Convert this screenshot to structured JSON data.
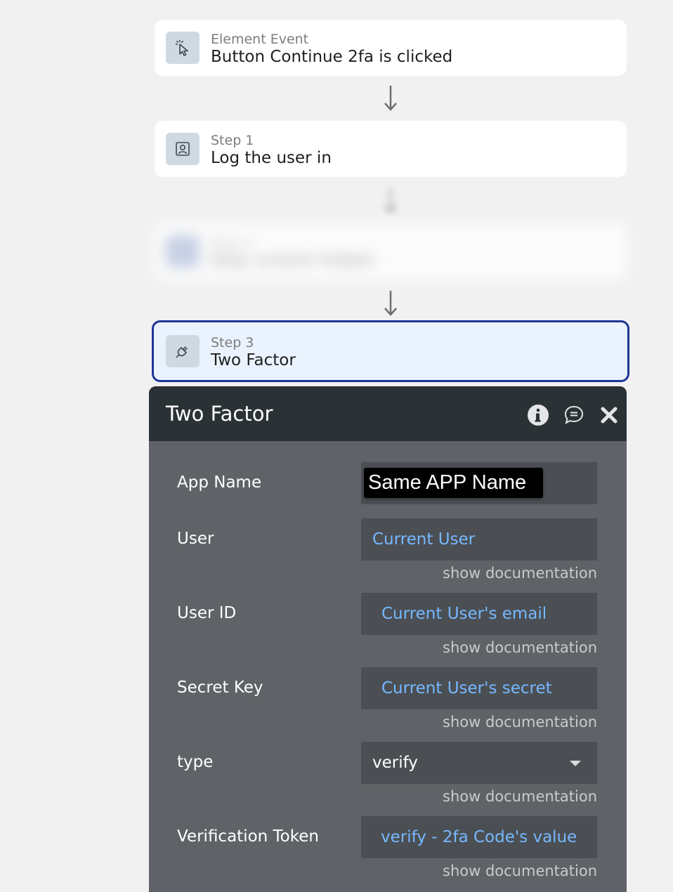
{
  "event": {
    "subtitle": "Element Event",
    "title": "Button Continue 2fa is clicked",
    "icon": "cursor-click-icon"
  },
  "step1": {
    "subtitle": "Step 1",
    "title": "Log the user in",
    "icon": "user-card-icon"
  },
  "step2": {
    "subtitle": "Step 2",
    "title": "Step content hidden",
    "icon": "blurred-icon"
  },
  "step3": {
    "subtitle": "Step 3",
    "title": "Two Factor",
    "icon": "plug-icon"
  },
  "panel": {
    "title": "Two Factor",
    "icons": [
      "info-icon",
      "comment-icon",
      "close-icon"
    ],
    "fields": {
      "app_name": {
        "label": "App Name",
        "value": "Same APP Name"
      },
      "user": {
        "label": "User",
        "value": "Current User",
        "doc": "show documentation"
      },
      "user_id": {
        "label": "User ID",
        "value": "Current User's email",
        "doc": "show documentation"
      },
      "secret_key": {
        "label": "Secret Key",
        "value": "Current User's secret",
        "doc": "show documentation"
      },
      "type": {
        "label": "type",
        "value": "verify",
        "doc": "show documentation"
      },
      "verification_token": {
        "label": "Verification Token",
        "value": "verify - 2fa Code's value",
        "doc": "show documentation"
      }
    }
  },
  "colors": {
    "selected_border": "#1d3596",
    "link": "#76b8ff",
    "panel_header": "#2b3235",
    "panel_body": "#5f6367"
  }
}
